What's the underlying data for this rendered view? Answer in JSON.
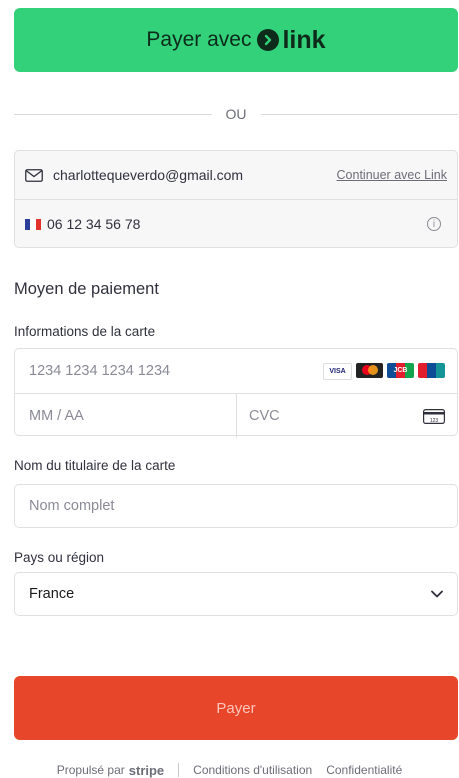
{
  "link_button": {
    "pay_with": "Payer avec",
    "brand": "link"
  },
  "divider": {
    "text": "OU"
  },
  "contact": {
    "email": "charlottequeverdo@gmail.com",
    "continue_link": "Continuer avec Link",
    "phone": "06 12 34 56 78"
  },
  "payment": {
    "title": "Moyen de paiement",
    "card_label": "Informations de la carte",
    "card_number_placeholder": "1234 1234 1234 1234",
    "expiry_placeholder": "MM / AA",
    "cvc_placeholder": "CVC",
    "cvc_icon_text": "123",
    "brands": [
      "VISA",
      "mastercard",
      "JCB",
      "UnionPay"
    ],
    "holder_label": "Nom du titulaire de la carte",
    "holder_placeholder": "Nom complet",
    "country_label": "Pays ou région",
    "country_value": "France"
  },
  "pay_button": {
    "label": "Payer"
  },
  "footer": {
    "powered_by": "Propulsé par",
    "stripe": "stripe",
    "terms": "Conditions d'utilisation",
    "privacy": "Confidentialité"
  },
  "colors": {
    "link_green": "#33d17a",
    "pay_orange": "#e8462b"
  }
}
